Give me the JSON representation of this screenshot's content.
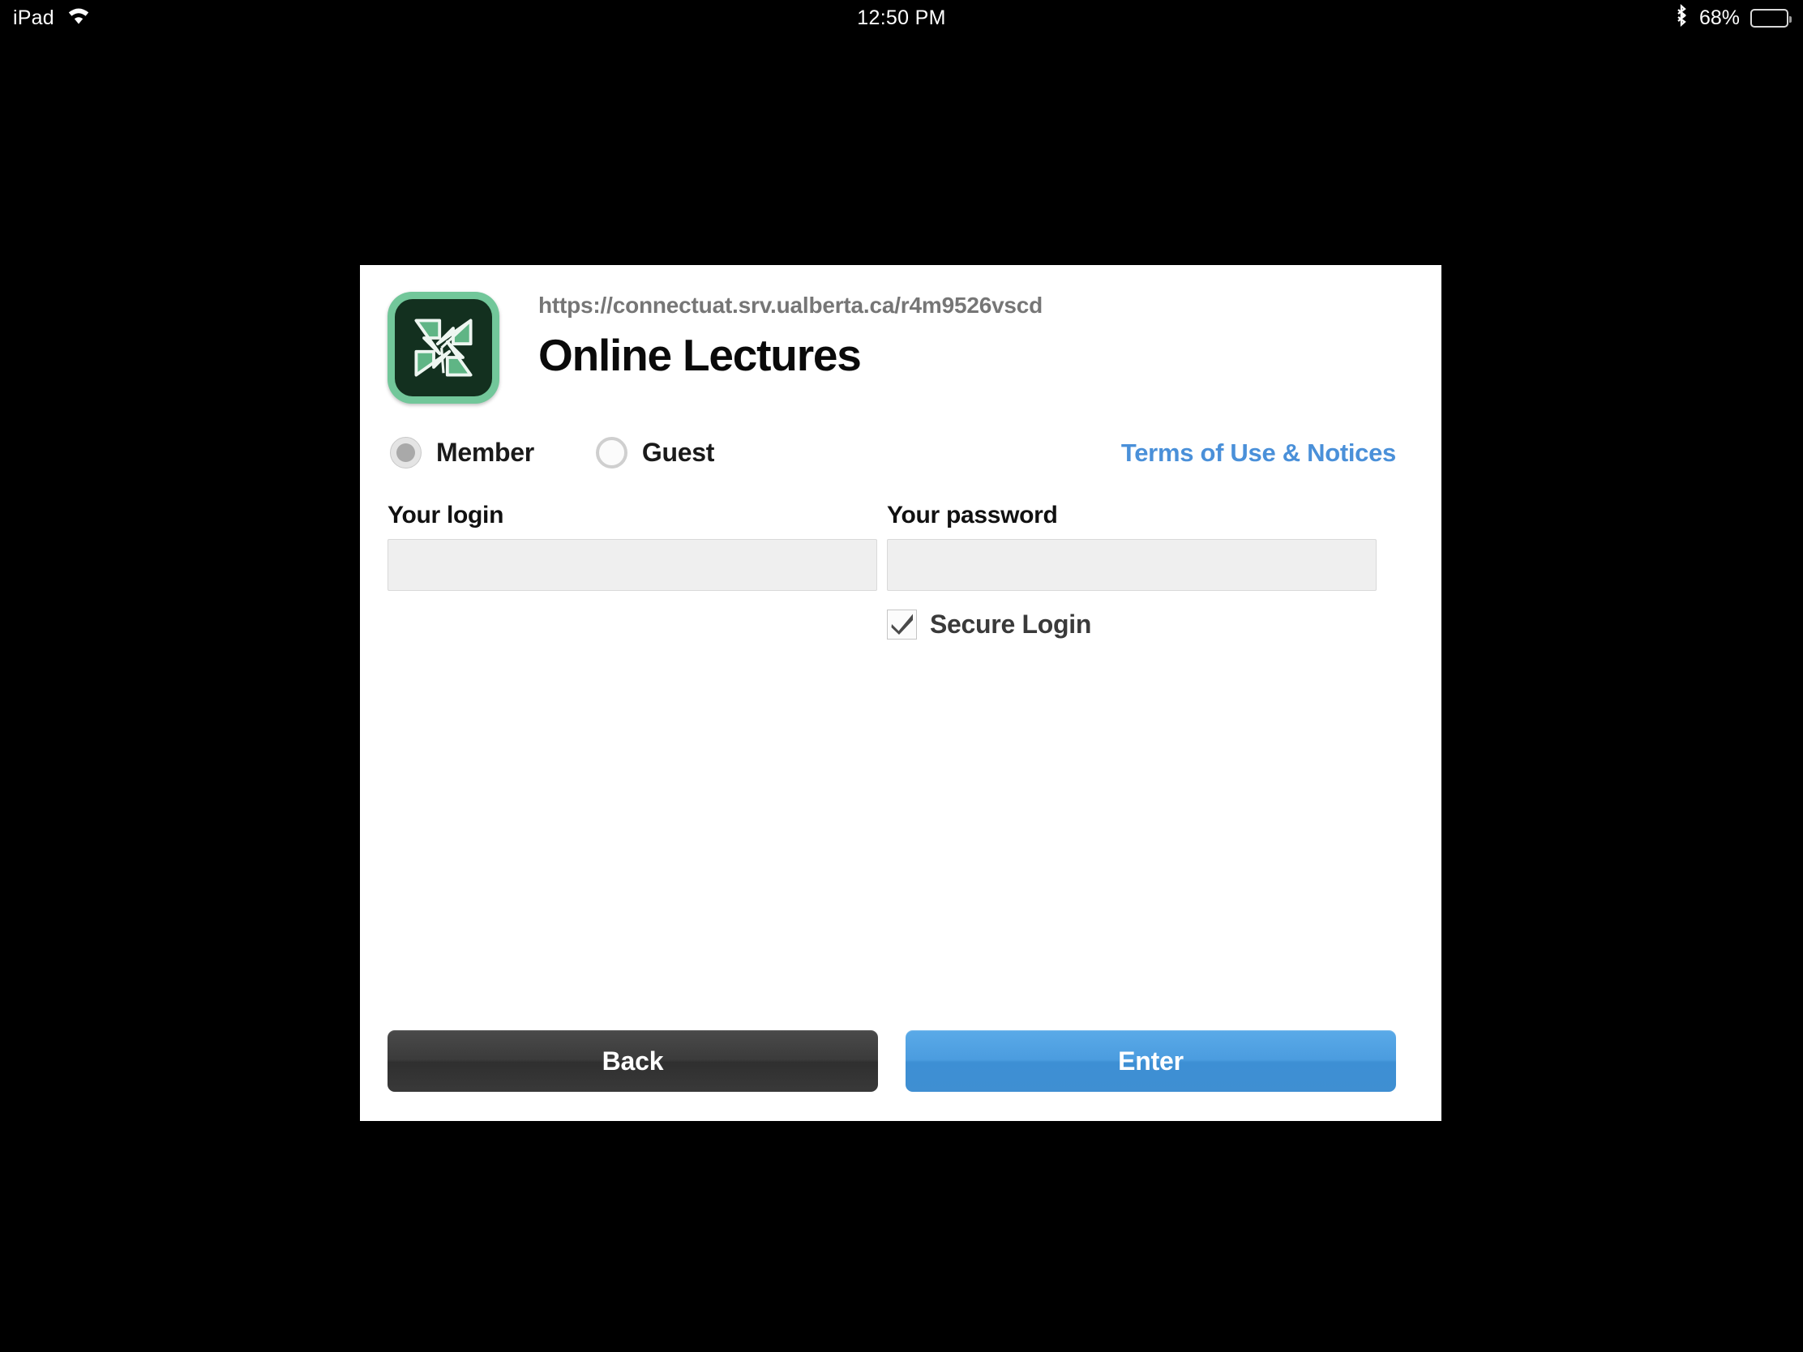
{
  "status_bar": {
    "device": "iPad",
    "wifi_icon": "wifi-icon",
    "time": "12:50 PM",
    "bluetooth_icon": "bluetooth-icon",
    "battery_percent": "68%",
    "battery_level": 68
  },
  "card": {
    "logo_icon": "app-logo-icon",
    "url": "https://connectuat.srv.ualberta.ca/r4m9526vscd",
    "title": "Online Lectures",
    "account_type": {
      "member_label": "Member",
      "guest_label": "Guest",
      "selected": "Member"
    },
    "terms_link": "Terms of Use & Notices",
    "login_field": {
      "label": "Your login",
      "value": "",
      "placeholder": ""
    },
    "password_field": {
      "label": "Your password",
      "value": "",
      "placeholder": ""
    },
    "secure_login": {
      "label": "Secure Login",
      "checked": true,
      "check_icon": "check-icon"
    },
    "buttons": {
      "back": "Back",
      "enter": "Enter"
    }
  },
  "colors": {
    "accent_blue": "#4a90d9",
    "enter_button": "#4b9cdf",
    "back_button": "#3b3b3b",
    "logo_border_green": "#72c79a",
    "logo_dark_green": "#13301f",
    "logo_square_green": "#5fb585",
    "url_gray": "#767676",
    "input_fill": "#efefef"
  }
}
